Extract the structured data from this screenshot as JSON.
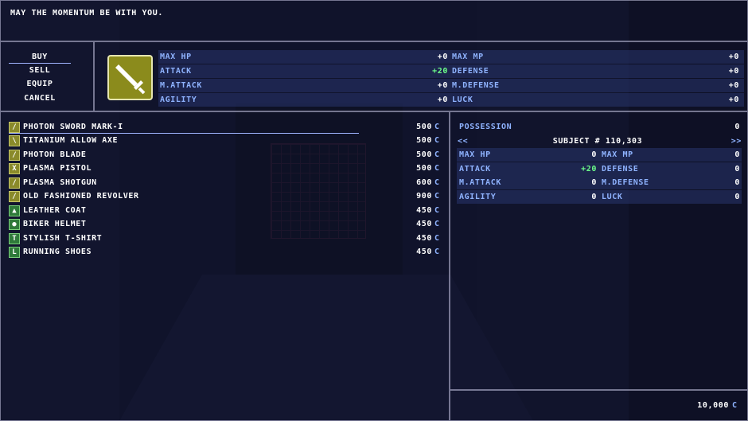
{
  "help_text": "MAY THE MOMENTUM BE WITH YOU.",
  "commands": [
    "BUY",
    "SELL",
    "EQUIP",
    "CANCEL"
  ],
  "status_compare": {
    "left": [
      {
        "label": "MAX HP",
        "value": "+0"
      },
      {
        "label": "ATTACK",
        "value": "+20"
      },
      {
        "label": "M.ATTACK",
        "value": "+0"
      },
      {
        "label": "AGILITY",
        "value": "+0"
      }
    ],
    "right": [
      {
        "label": "MAX MP",
        "value": "+0"
      },
      {
        "label": "DEFENSE",
        "value": "+0"
      },
      {
        "label": "M.DEFENSE",
        "value": "+0"
      },
      {
        "label": "LUCK",
        "value": "+0"
      }
    ]
  },
  "currency_unit": "C",
  "items": [
    {
      "name": "PHOTON SWORD MARK-I",
      "price": "500",
      "icon": "sword-icon"
    },
    {
      "name": "TITANIUM ALLOW AXE",
      "price": "500",
      "icon": "axe-icon"
    },
    {
      "name": "PHOTON BLADE",
      "price": "500",
      "icon": "sword-icon"
    },
    {
      "name": "PLASMA PISTOL",
      "price": "500",
      "icon": "gun-icon"
    },
    {
      "name": "PLASMA SHOTGUN",
      "price": "600",
      "icon": "gun-icon"
    },
    {
      "name": "OLD FASHIONED REVOLVER",
      "price": "900",
      "icon": "gun-icon"
    },
    {
      "name": "LEATHER COAT",
      "price": "450",
      "icon": "armor-icon"
    },
    {
      "name": "BIKER HELMET",
      "price": "450",
      "icon": "helmet-icon"
    },
    {
      "name": "STYLISH T-SHIRT",
      "price": "450",
      "icon": "shirt-icon"
    },
    {
      "name": "RUNNING SHOES",
      "price": "450",
      "icon": "shoes-icon"
    }
  ],
  "possession": {
    "label": "POSSESSION",
    "value": "0"
  },
  "subject": {
    "prev": "<<",
    "name": "SUBJECT # 110,303",
    "next": ">>"
  },
  "subject_stats": {
    "left": [
      {
        "label": "MAX HP",
        "value": "0"
      },
      {
        "label": "ATTACK",
        "value": "+20"
      },
      {
        "label": "M.ATTACK",
        "value": "0"
      },
      {
        "label": "AGILITY",
        "value": "0"
      }
    ],
    "right": [
      {
        "label": "MAX MP",
        "value": "0"
      },
      {
        "label": "DEFENSE",
        "value": "0"
      },
      {
        "label": "M.DEFENSE",
        "value": "0"
      },
      {
        "label": "LUCK",
        "value": "0"
      }
    ]
  },
  "gold": {
    "value": "10,000",
    "unit": "C"
  }
}
